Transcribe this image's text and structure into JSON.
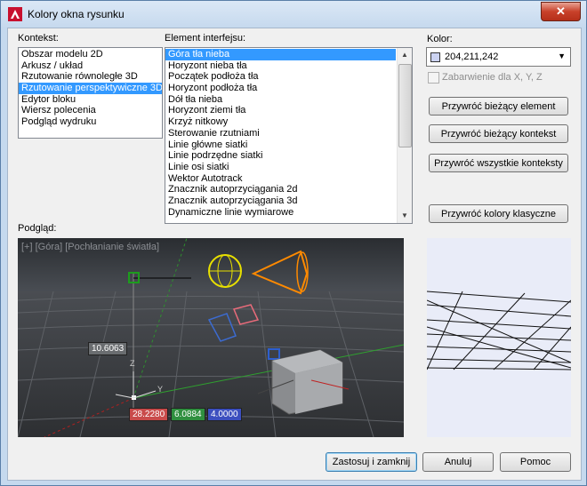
{
  "window": {
    "title": "Kolory okna rysunku",
    "close_glyph": "✕"
  },
  "context": {
    "label": "Kontekst:",
    "items": [
      "Obszar modelu 2D",
      "Arkusz / układ",
      "Rzutowanie równoległe 3D",
      "Rzutowanie perspektywiczne 3D",
      "Edytor bloku",
      "Wiersz polecenia",
      "Podgląd wydruku"
    ],
    "selected_index": 3
  },
  "elements": {
    "label": "Element interfejsu:",
    "items": [
      "Góra tła nieba",
      "Horyzont nieba tła",
      "Początek podłoża tła",
      "Horyzont podłoża tła",
      "Dół tła nieba",
      "Horyzont ziemi tła",
      "Krzyż nitkowy",
      "Sterowanie rzutniami",
      "Linie główne siatki",
      "Linie podrzędne siatki",
      "Linie osi siatki",
      "Wektor Autotrack",
      "Znacznik autoprzyciągania 2d",
      "Znacznik autoprzyciągania 3d",
      "Dynamiczne linie wymiarowe"
    ],
    "selected_index": 0
  },
  "color": {
    "label": "Kolor:",
    "value": "204,211,242",
    "swatch_color": "#ccd3f2",
    "tint_label": "Zabarwienie dla X, Y, Z"
  },
  "buttons": {
    "restore_element": "Przywróć bieżący element",
    "restore_context": "Przywróć bieżący kontekst",
    "restore_all": "Przywróć wszystkie konteksty",
    "restore_classic": "Przywróć kolory klasyczne",
    "apply_close": "Zastosuj i zamknij",
    "cancel": "Anuluj",
    "help": "Pomoc"
  },
  "preview": {
    "label": "Podgląd:",
    "viewport_label": "[+] [Góra] [Pochłanianie światła]",
    "dim_value": "10.6063",
    "coord_x": "28.2280",
    "coord_y": "6.0884",
    "coord_z": "4.0000",
    "axis_z": "Z",
    "axis_y": "Y"
  }
}
